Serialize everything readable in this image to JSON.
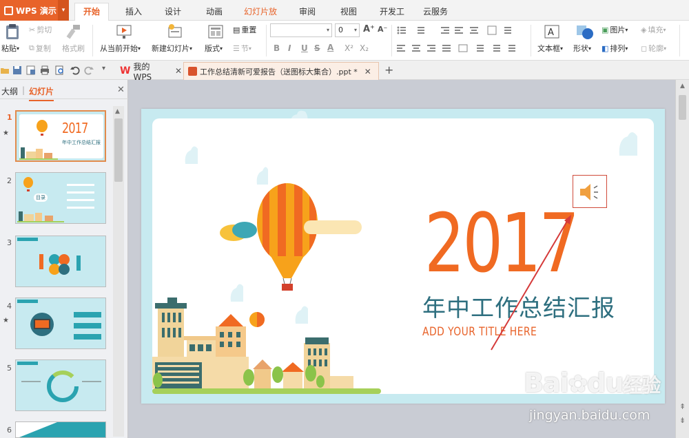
{
  "app": {
    "name": "WPS 演示",
    "colors": {
      "accent": "#e8632a",
      "slide_bg": "#c7eaf0",
      "title_orange": "#f06a22",
      "title_teal": "#2e6f7f"
    }
  },
  "menu": {
    "tabs": [
      "开始",
      "插入",
      "设计",
      "动画",
      "幻灯片放映",
      "审阅",
      "视图",
      "开发工具",
      "云服务"
    ],
    "active": "开始"
  },
  "ribbon": {
    "paste": "粘贴",
    "cut": "剪切",
    "copy": "复制",
    "format_painter": "格式刷",
    "from_current": "从当前开始",
    "new_slide": "新建幻灯片",
    "layout": "版式",
    "reset": "重置",
    "section": "节",
    "font_size": "0",
    "text_box": "文本框",
    "shape": "形状",
    "picture": "图片",
    "arrange": "排列",
    "fill": "填充",
    "outline": "轮廓",
    "bold": "B",
    "italic": "I",
    "underline": "U",
    "strike": "S",
    "font_color": "A",
    "superscript": "X²",
    "subscript": "X₂",
    "grow_font": "A⁺",
    "shrink_font": "A⁻"
  },
  "doctabs": {
    "home": "我的WPS",
    "file": "工作总结清新可爱报告（送图标大集合）.ppt *"
  },
  "leftpane": {
    "outline_tab": "大纲",
    "slides_tab": "幻灯片",
    "slide_numbers": [
      "1",
      "2",
      "3",
      "4",
      "5",
      "6"
    ],
    "thumb1_year": "2017",
    "thumb1_sub": "年中工作总结汇报",
    "thumb2_label": "目录"
  },
  "slide": {
    "year": "2017",
    "subtitle": "年中工作总结汇报",
    "tagline": "ADD YOUR TITLE HERE"
  },
  "watermark": {
    "brand": "Bai",
    "brand2": "du",
    "brand3": "经验",
    "url": "jingyan.baidu.com"
  }
}
